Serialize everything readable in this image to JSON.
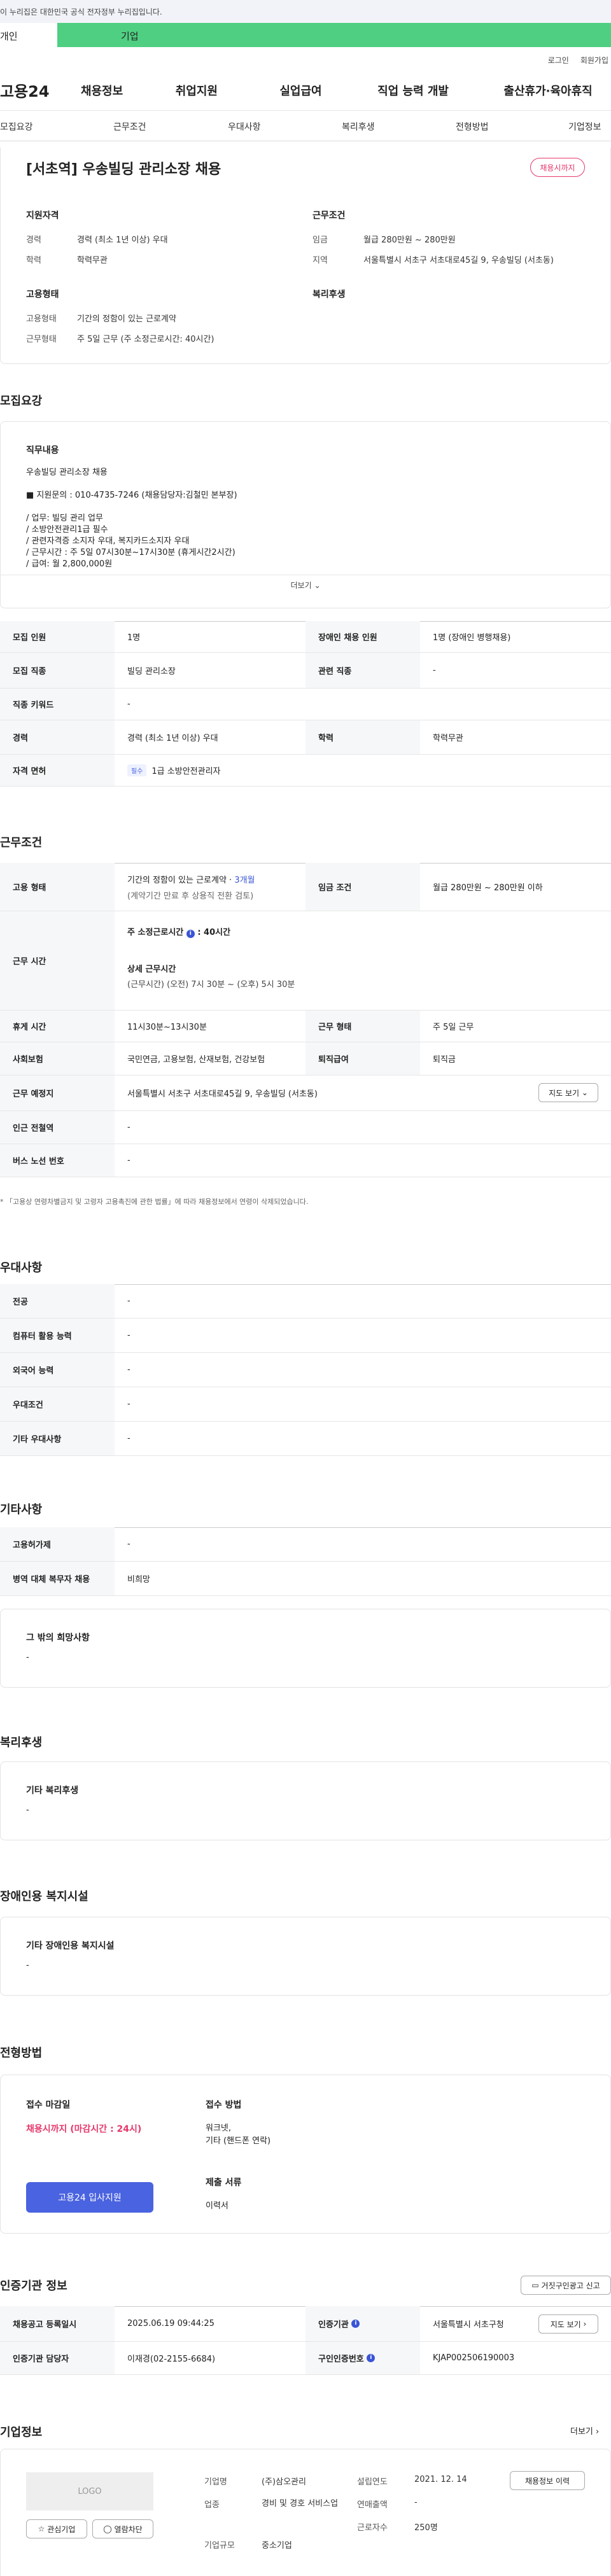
{
  "gov_banner": "이 누리집은 대한민국 공식 전자정부 누리집입니다.",
  "user_tabs": [
    "개인",
    "기업"
  ],
  "top_links": [
    "로그인",
    "회원가입"
  ],
  "logo": "고용24",
  "gnb": [
    "채용정보",
    "취업지원",
    "실업급여",
    "직업 능력 개발",
    "출산휴가·육아휴직"
  ],
  "snb": [
    "모집요강",
    "근무조건",
    "우대사항",
    "복리후생",
    "전형방법",
    "기업정보"
  ],
  "job": {
    "title": "[서초역] 우송빌딩 관리소장 채용",
    "badge": "채용시까지",
    "qual_title": "지원자격",
    "cond_title": "근무조건",
    "emp_title": "고용형태",
    "welfare_title": "복리후생",
    "qual": [
      {
        "k": "경력",
        "v": "경력 (최소 1년 이상) 우대"
      },
      {
        "k": "학력",
        "v": "학력무관"
      }
    ],
    "cond": [
      {
        "k": "임금",
        "v": "월급 280만원 ~ 280만원"
      },
      {
        "k": "지역",
        "v": "서울특별시 서초구 서초대로45길 9, 우송빌딩 (서초동)"
      }
    ],
    "emp": [
      {
        "k": "고용형태",
        "v": "기간의 정함이 있는 근로계약"
      },
      {
        "k": "근무형태",
        "v": "주 5일 근무 (주 소정근로시간: 40시간)"
      }
    ]
  },
  "recruit": {
    "heading": "모집요강",
    "desc_title": "직무내용",
    "desc_lines": [
      "우송빌딩 관리소장 채용",
      "■ 지원문의 : 010-4735-7246 (채용담당자:김철민 본부장)",
      "/ 업무: 빌딩 관리 업무",
      "/ 소방안전관리1급 필수",
      "/ 관련자격증 소지자 우대, 복지카드소지자 우대",
      "/ 근무시간 : 주 5일 07시30분~17시30분 (휴게시간2시간)",
      "/ 급여: 월 2,800,000원"
    ],
    "more": "더보기",
    "rows": [
      {
        "k1": "모집 인원",
        "v1": "1명",
        "k2": "장애인 채용 인원",
        "v2": "1명 (장애인 병행채용)"
      },
      {
        "k1": "모집 직종",
        "v1": "빌딩 관리소장",
        "k2": "관련 직종",
        "v2": "-"
      },
      {
        "k1": "직종 키워드",
        "v1": "-"
      },
      {
        "k1": "경력",
        "v1": "경력 (최소 1년 이상) 우대",
        "k2": "학력",
        "v2": "학력무관"
      }
    ],
    "license_label": "자격 면허",
    "license_tag": "필수",
    "license_value": "1급 소방안전관리자"
  },
  "work": {
    "heading": "근무조건",
    "emp_label": "고용 형태",
    "emp_value": "기간의 정함이 있는 근로계약 ·",
    "emp_months": "3개월",
    "emp_note": "(계약기간 만료 후 상용직 전환 검토)",
    "wage_label": "임금 조건",
    "wage_value": "월급 280만원 ~ 280만원 이하",
    "time_label": "근무 시간",
    "time_title": "주 소정근로시간",
    "time_hours": ": 40시간",
    "detail_title": "상세 근무시간",
    "detail_value": "(근무시간) (오전) 7시 30분 ~ (오후) 5시 30분",
    "rows": [
      {
        "k1": "휴게 시간",
        "v1": "11시30분~13시30분",
        "k2": "근무 형태",
        "v2": "주 5일 근무"
      },
      {
        "k1": "사회보험",
        "v1": "국민연금, 고용보험, 산재보험, 건강보험",
        "k2": "퇴직급여",
        "v2": "퇴직금"
      }
    ],
    "place_label": "근무 예정지",
    "place_value": "서울특별시 서초구 서초대로45길 9, 우송빌딩 (서초동)",
    "map_btn": "지도 보기",
    "station_label": "인근 전철역",
    "station_value": "-",
    "bus_label": "버스 노선 번호",
    "bus_value": "-",
    "footnote": "* 「고용상 연령차별금지 및 고령자 고용촉진에 관한 법률」에 따라 채용정보에서 연령이 삭제되었습니다."
  },
  "prefer": {
    "heading": "우대사항",
    "rows": [
      {
        "k": "전공",
        "v": "-"
      },
      {
        "k": "컴퓨터 활용 능력",
        "v": "-"
      },
      {
        "k": "외국어 능력",
        "v": "-"
      },
      {
        "k": "우대조건",
        "v": "-"
      },
      {
        "k": "기타 우대사항",
        "v": "-"
      }
    ]
  },
  "etc": {
    "heading": "기타사항",
    "rows": [
      {
        "k": "고용허가제",
        "v": "-"
      },
      {
        "k": "병역 대체 복무자 채용",
        "v": "비희망"
      }
    ],
    "other_title": "그 밖의 희망사항",
    "other_value": "-"
  },
  "welfare": {
    "heading": "복리후생",
    "title": "기타 복리후생",
    "value": "-"
  },
  "disabled": {
    "heading": "장애인용 복지시설",
    "title": "기타 장애인용 복지시설",
    "value": "-"
  },
  "process": {
    "heading": "전형방법",
    "deadline_label": "접수 마감일",
    "deadline_value": "채용시까지 (마감시간 : 24시)",
    "apply_btn": "고용24 입사지원",
    "method_label": "접수 방법",
    "method_value": "워크넷,",
    "method_value2": "기타 (핸드폰 연락)",
    "docs_label": "제출 서류",
    "docs_value": "이력서"
  },
  "cert": {
    "heading": "인증기관 정보",
    "report_btn": "거짓구인광고 신고",
    "rows": [
      {
        "k1": "채용공고 등록일시",
        "v1": "2025.06.19 09:44:25",
        "k2": "인증기관",
        "v2": "서울특별시 서초구청"
      },
      {
        "k1": "인증기관 담당자",
        "v1": "이재경(02-2155-6684)",
        "k2": "구인인증번호",
        "v2": "KJAP002506190003"
      }
    ],
    "map_btn": "지도 보기"
  },
  "company": {
    "heading": "기업정보",
    "more": "더보기",
    "logo_text": "LOGO",
    "fav_btn": "관심기업",
    "block_btn": "열람차단",
    "info": [
      {
        "k": "기업명",
        "v": "(주)삼오관리"
      },
      {
        "k": "업종",
        "v": "경비 및 경호 서비스업"
      },
      {
        "k": "기업규모",
        "v": "중소기업"
      }
    ],
    "info2": [
      {
        "k": "설립연도",
        "v": "2021. 12. 14"
      },
      {
        "k": "연매출액",
        "v": "-"
      },
      {
        "k": "근로자수",
        "v": "250명"
      }
    ],
    "history_btn": "채용정보 이력"
  }
}
